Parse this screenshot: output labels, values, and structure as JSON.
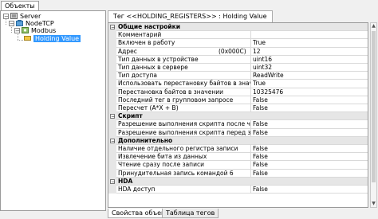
{
  "top_tab": "Объекты",
  "tree": {
    "server": "Server",
    "nodetcp": "NodeTCP",
    "modbus": "Modbus",
    "holding": "Holding Value"
  },
  "title_tab": "Тег  <<HOLDING_REGISTERS>> : Holding Value",
  "properties": [
    {
      "type": "cat",
      "name": "Общие настройки"
    },
    {
      "type": "row",
      "name": "Комментарий",
      "value": ""
    },
    {
      "type": "row",
      "name": "Включен в работу",
      "value": "True"
    },
    {
      "type": "row",
      "name": "Адрес",
      "extra": "(0x000C)",
      "value": "12"
    },
    {
      "type": "row",
      "name": "Тип данных в устройстве",
      "value": "uint16"
    },
    {
      "type": "row",
      "name": "Тип данных в сервере",
      "value": "uint32"
    },
    {
      "type": "row",
      "name": "Тип доступа",
      "value": "ReadWrite"
    },
    {
      "type": "row",
      "name": "Использовать перестановку байтов в значении",
      "value": "True"
    },
    {
      "type": "row",
      "name": "Перестановка байтов в значении",
      "value": "10325476"
    },
    {
      "type": "row",
      "name": "Последний тег в групповом запросе",
      "value": "False"
    },
    {
      "type": "row",
      "name": "Пересчет (A*X + B)",
      "value": "False"
    },
    {
      "type": "cat",
      "name": "Скрипт"
    },
    {
      "type": "row",
      "name": "Разрешение выполнения скрипта после чтения",
      "value": "False"
    },
    {
      "type": "row",
      "name": "Разрешение выполнения скрипта перед записью",
      "value": "False"
    },
    {
      "type": "cat",
      "name": "Дополнительно"
    },
    {
      "type": "row",
      "name": "Наличие отдельного регистра записи",
      "value": "False"
    },
    {
      "type": "row",
      "name": "Извлечение бита из данных",
      "value": "False"
    },
    {
      "type": "row",
      "name": "Чтение сразу после записи",
      "value": "False"
    },
    {
      "type": "row",
      "name": "Принудительная запись командой 6",
      "value": "False"
    },
    {
      "type": "cat",
      "name": "HDA"
    },
    {
      "type": "row",
      "name": "HDA доступ",
      "value": "False"
    }
  ],
  "bottom_tabs": [
    "Свойства объекта",
    "Таблица тегов"
  ]
}
